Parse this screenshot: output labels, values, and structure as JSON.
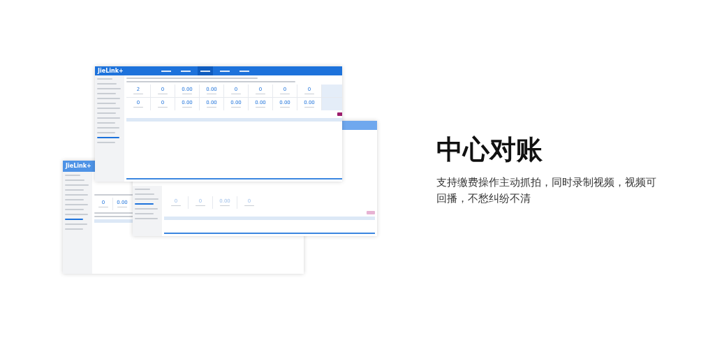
{
  "collage": {
    "front": {
      "logo": "JieLink+",
      "nav_tabs": [
        {
          "selected": false
        },
        {
          "selected": false
        },
        {
          "selected": true
        },
        {
          "selected": false
        },
        {
          "selected": false
        }
      ],
      "stats": [
        [
          "2",
          "0",
          "0.00",
          "0.00",
          "0",
          "0",
          "0",
          "0"
        ],
        [
          "0",
          "0",
          "0.00",
          "0.00",
          "0.00",
          "0.00",
          "0.00",
          "0.00"
        ]
      ]
    },
    "middle": {
      "stats": [
        "0",
        "0",
        "0.00",
        "0"
      ]
    },
    "back": {
      "logo": "JieLink+",
      "stats": [
        "0",
        "0.00"
      ]
    }
  },
  "heading": "中心对账",
  "description": "支持缴费操作主动抓拍，同时录制视频，视频可回播，不愁纠纷不清"
}
